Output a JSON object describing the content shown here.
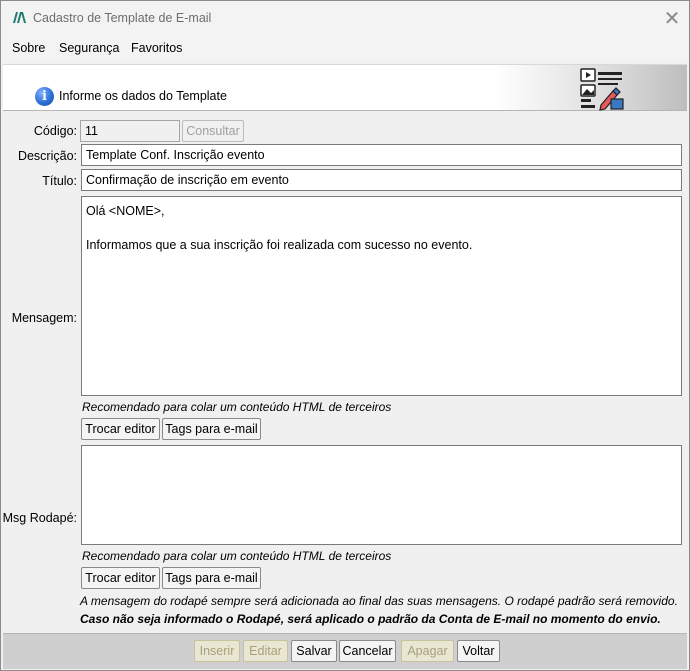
{
  "window": {
    "title": "Cadastro de Template de E-mail",
    "close_glyph": "✕"
  },
  "menu": [
    {
      "label": "Sobre"
    },
    {
      "label": "Segurança"
    },
    {
      "label": "Favoritos"
    }
  ],
  "header": {
    "text": "Informe os dados do Template",
    "info_icon": "info-icon",
    "image_icon": "email-template-icon"
  },
  "form": {
    "codigo": {
      "label": "Código:",
      "value": "11"
    },
    "consultar_label": "Consultar",
    "descricao": {
      "label": "Descrição:",
      "value": "Template Conf. Inscrição evento"
    },
    "titulo": {
      "label": "Título:",
      "value": "Confirmação de inscrição em evento"
    },
    "mensagem": {
      "label": "Mensagem:",
      "value": "Olá <NOME>,\n\nInformamos que a sua inscrição foi realizada com sucesso no evento."
    },
    "mensagem_hint": "Recomendado para colar um conteúdo HTML de terceiros",
    "trocar_editor_label": "Trocar editor",
    "tags_label": "Tags para e-mail",
    "rodape": {
      "label": "Msg Rodapé:",
      "value": ""
    },
    "rodape_hint": "Recomendado para colar um conteúdo HTML de terceiros",
    "note_italic": "A mensagem do rodapé sempre será adicionada ao final das suas mensagens. O rodapé padrão será removido.",
    "note_bold": "Caso não seja informado o Rodapé, será aplicado o padrão da Conta de E-mail no momento do envio."
  },
  "footer_buttons": [
    {
      "label": "Inserir",
      "enabled": false
    },
    {
      "label": "Editar",
      "enabled": false
    },
    {
      "label": "Salvar",
      "enabled": true
    },
    {
      "label": "Cancelar",
      "enabled": true
    },
    {
      "label": "Apagar",
      "enabled": false
    },
    {
      "label": "Voltar",
      "enabled": true
    }
  ],
  "colors": {
    "info_icon": "#2d6fd6",
    "footer_bg": "#cfcfcf",
    "disabled_text": "#a7a07a"
  }
}
